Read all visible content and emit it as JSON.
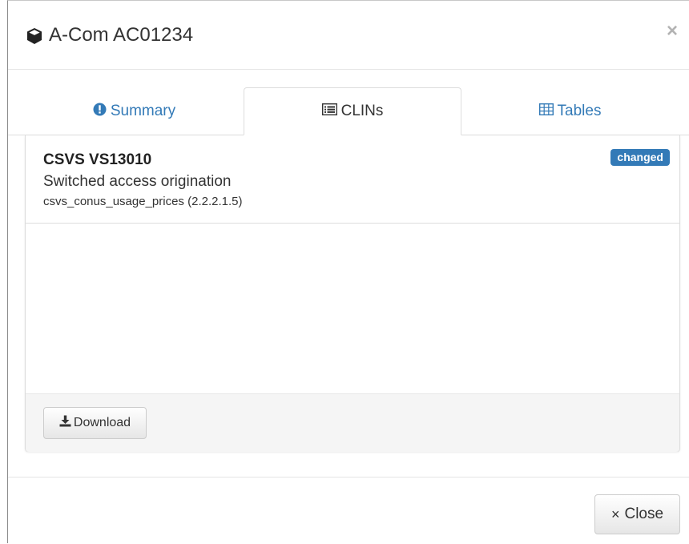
{
  "header": {
    "title": "A-Com AC01234",
    "title_icon": "cube-icon",
    "close_symbol": "×"
  },
  "tabs": [
    {
      "label": "Summary",
      "icon": "exclamation-circle-icon",
      "active": false
    },
    {
      "label": "CLINs",
      "icon": "list-alt-icon",
      "active": true
    },
    {
      "label": "Tables",
      "icon": "table-icon",
      "active": false
    }
  ],
  "clin": {
    "code": "CSVS VS13010",
    "name": "Switched access origination",
    "source": "csvs_conus_usage_prices (2.2.2.1.5)",
    "badge": "changed"
  },
  "panel": {
    "download_label": "Download",
    "download_icon": "download-icon"
  },
  "footer": {
    "close_label": "Close",
    "close_symbol": "×"
  },
  "colors": {
    "link": "#337ab7",
    "badge_bg": "#337ab7",
    "footer_bg": "#f5f5f5"
  }
}
